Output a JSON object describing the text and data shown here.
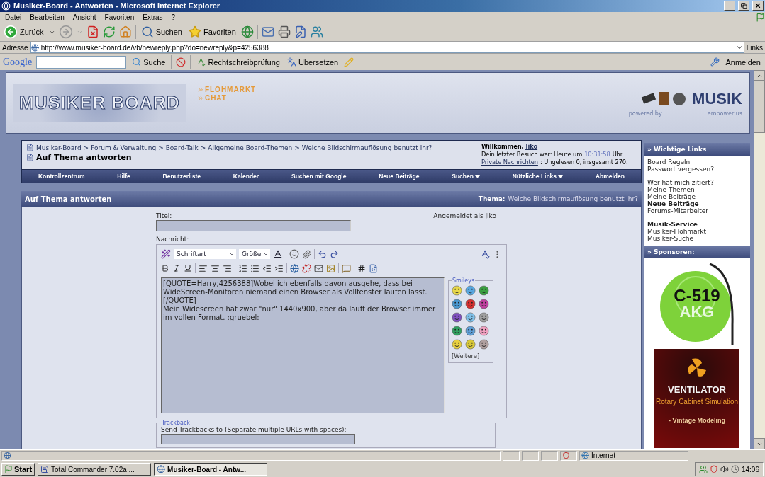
{
  "window": {
    "title": "Musiker-Board - Antworten - Microsoft Internet Explorer"
  },
  "menu": [
    "Datei",
    "Bearbeiten",
    "Ansicht",
    "Favoriten",
    "Extras",
    "?"
  ],
  "toolbar": {
    "back": "Zurück",
    "search": "Suchen",
    "favorites": "Favoriten"
  },
  "address": {
    "label": "Adresse",
    "value": "http://www.musiker-board.de/vb/newreply.php?do=newreply&p=4256388",
    "links": "Links"
  },
  "google_bar": {
    "logo": "Google",
    "search": "Suche",
    "spell": "Rechtschreibprüfung",
    "translate": "Übersetzen",
    "signin": "Anmelden"
  },
  "banner": {
    "logo": "MUSIKER BOARD",
    "links": [
      "FLOHMARKT",
      "CHAT"
    ],
    "service_logo": "MUSIK",
    "powered": "powered by...",
    "empower": "...empower us"
  },
  "breadcrumb": {
    "separator": ">",
    "items": [
      "Musiker-Board",
      "Forum & Verwaltung",
      "Board-Talk",
      "Allgemeine Board-Themen",
      "Welche Bildschirmauflösung benutzt ihr?"
    ],
    "current": "Auf Thema antworten"
  },
  "welcome": {
    "greeting": "Willkommen,",
    "user": "Jiko",
    "last_visit": "Dein letzter Besuch war: Heute um",
    "time": "10:31:58",
    "time_suffix": "Uhr",
    "pm_link": "Private Nachrichten",
    "pm_text": ": Ungelesen 0, insgesamt 270."
  },
  "navbar": [
    {
      "label": "Kontrollzentrum",
      "dropdown": false
    },
    {
      "label": "Hilfe",
      "dropdown": false
    },
    {
      "label": "Benutzerliste",
      "dropdown": false
    },
    {
      "label": "Kalender",
      "dropdown": false
    },
    {
      "label": "Suchen mit Google",
      "dropdown": false
    },
    {
      "label": "Neue Beiträge",
      "dropdown": false
    },
    {
      "label": "Suchen",
      "dropdown": true
    },
    {
      "label": "Nützliche Links",
      "dropdown": true
    },
    {
      "label": "Abmelden",
      "dropdown": false
    }
  ],
  "panel": {
    "title": "Auf Thema antworten",
    "thread_label": "Thema:",
    "thread_link": "Welche Bildschirmauflösung benutzt ihr?"
  },
  "form": {
    "title_label": "Titel:",
    "logged_in": "Angemeldet als Jiko",
    "message_label": "Nachricht:",
    "font": "Schriftart",
    "size": "Größe",
    "message": "[QUOTE=Harry;4256388]Wobei ich ebenfalls davon ausgehe, dass bei WideScreen-Monitoren niemand einen Browser als Vollfenster laufen lässt.\n[/QUOTE]\nMein Widescreen hat zwar \"nur\" 1440x900, aber da läuft der Browser immer im vollen Format. :gruebel:",
    "smilies_title": "Smileys",
    "smilies": [
      {
        "color": "#e8d84a"
      },
      {
        "color": "#5aa8e0"
      },
      {
        "color": "#3aa040"
      },
      {
        "color": "#4a98d0"
      },
      {
        "color": "#d83030"
      },
      {
        "color": "#c040a0"
      },
      {
        "color": "#8050c0"
      },
      {
        "color": "#80c0e8"
      },
      {
        "color": "#a0a0a0"
      },
      {
        "color": "#30a060"
      },
      {
        "color": "#60a0d8"
      },
      {
        "color": "#f0a0c0"
      },
      {
        "color": "#e8d040"
      },
      {
        "color": "#d8c838"
      },
      {
        "color": "#b0a0a0"
      }
    ],
    "more": "[Weitere]",
    "trackback_legend": "Trackback",
    "trackback_label": "Send Trackbacks to (Separate multiple URLs with spaces):"
  },
  "sidebar": {
    "links_title": "» Wichtige Links",
    "groups": [
      [
        {
          "label": "Board Regeln",
          "bold": false
        },
        {
          "label": "Passwort vergessen?",
          "bold": false
        }
      ],
      [
        {
          "label": "Wer hat mich zitiert?",
          "bold": false
        },
        {
          "label": "Meine Themen",
          "bold": false
        },
        {
          "label": "Meine Beiträge",
          "bold": false
        },
        {
          "label": "Neue Beiträge",
          "bold": true
        },
        {
          "label": "Forums-Mitarbeiter",
          "bold": false
        }
      ],
      [
        {
          "label": "Musik-Service",
          "bold": true
        },
        {
          "label": "Musiker-Flohmarkt",
          "bold": false
        },
        {
          "label": "Musiker-Suche",
          "bold": false
        }
      ]
    ],
    "sponsors_title": "» Sponsoren:",
    "sponsors": [
      {
        "kind": "akg",
        "lines": [
          "C-519",
          "AKG"
        ]
      },
      {
        "kind": "ventilator",
        "lines": [
          "VENTILATOR",
          "Rotary Cabinet Simulation",
          "- Vintage Modeling"
        ]
      }
    ]
  },
  "status_bar": {
    "zone": "Internet"
  },
  "taskbar": {
    "start": "Start",
    "tasks": [
      {
        "label": "Total Commander 7.02a ...",
        "selected": false
      },
      {
        "label": "Musiker-Board - Antw...",
        "selected": true
      }
    ],
    "clock": "14:06"
  }
}
